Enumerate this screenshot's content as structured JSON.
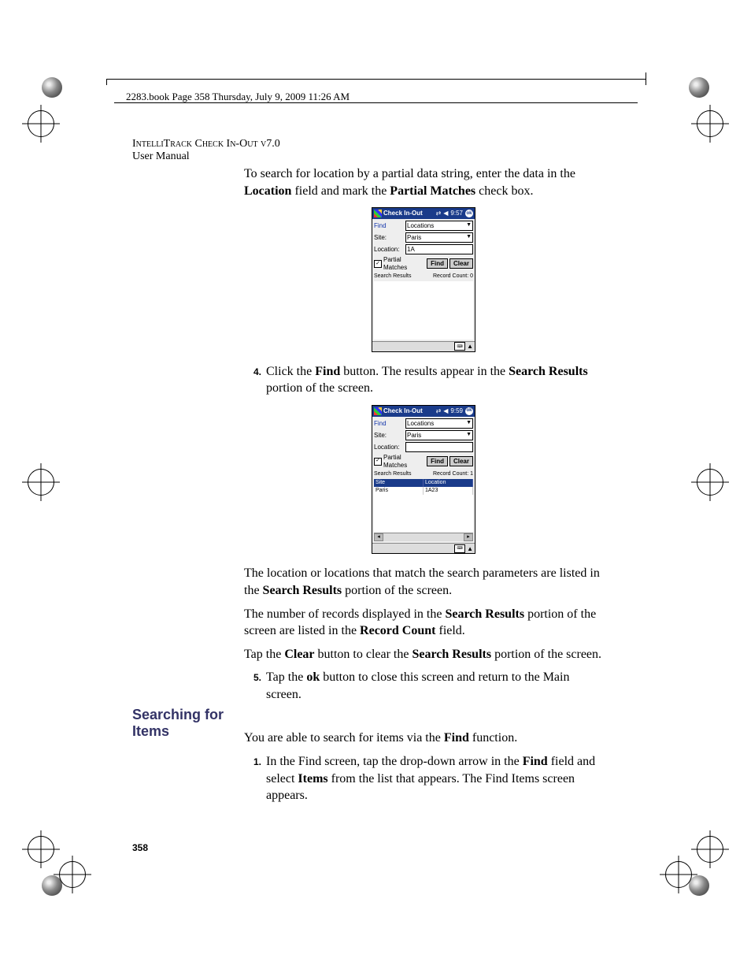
{
  "book_header": "2283.book  Page 358  Thursday, July 9, 2009  11:26 AM",
  "title_line1": "IntelliTrack Check In-Out v7.0",
  "title_line2": "User Manual",
  "intro": {
    "t1a": "To search for location by a partial data string, enter the data in the ",
    "t1b": "Location",
    "t1c": " field and mark the ",
    "t1d": "Partial Matches",
    "t1e": " check box."
  },
  "dev": {
    "title": "Check In-Out",
    "time1": "9:57",
    "time2": "9:59",
    "ok": "ok",
    "find_label": "Find",
    "find_value": "Locations",
    "site_label": "Site:",
    "site_value": "Paris",
    "loc_label": "Location:",
    "loc_value1": "1A",
    "loc_value2": "",
    "partial": "Partial Matches",
    "find_btn": "Find",
    "clear_btn": "Clear",
    "results": "Search Results",
    "rc_label": "Record Count:",
    "rc0": "0",
    "rc1": "1",
    "col_site": "Site",
    "col_loc": "Location",
    "row_site": "Paris",
    "row_loc": "1A23"
  },
  "step4": {
    "num": "4.",
    "a": "Click the ",
    "b": "Find",
    "c": " button. The results appear in the ",
    "d": "Search Results",
    "e": " portion of the screen."
  },
  "post": {
    "p1a": "The location or locations that match the search parameters are listed in the ",
    "p1b": "Search Results",
    "p1c": " portion of the screen.",
    "p2a": "The number of records displayed in the ",
    "p2b": "Search Results",
    "p2c": " portion of the screen are listed in the ",
    "p2d": "Record Count",
    "p2e": " field.",
    "p3a": "Tap the ",
    "p3b": "Clear",
    "p3c": " button to clear the ",
    "p3d": "Search Results",
    "p3e": " portion of the screen."
  },
  "step5": {
    "num": "5.",
    "a": "Tap the ",
    "b": "ok",
    "c": " button to close this screen and return to the Main screen."
  },
  "section_head": "Searching for Items",
  "sect": {
    "intro_a": "You are able to search for items via the ",
    "intro_b": "Find",
    "intro_c": " function.",
    "s1_num": "1.",
    "s1a": "In the Find screen, tap the drop-down arrow in the ",
    "s1b": "Find",
    "s1c": " field and select ",
    "s1d": "Items",
    "s1e": " from the list that appears. The Find Items screen appears."
  },
  "page_num": "358"
}
